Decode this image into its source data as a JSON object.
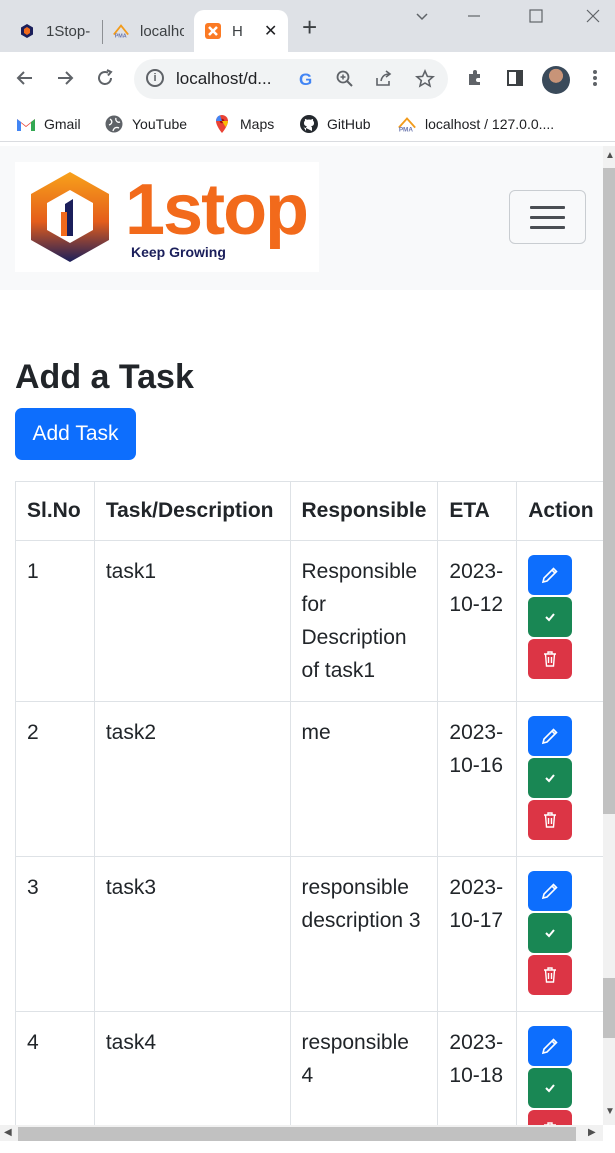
{
  "browser": {
    "tabs": [
      {
        "label": "1Stop-"
      },
      {
        "label": "localho"
      },
      {
        "label": "H"
      }
    ],
    "address": "localhost/d...",
    "bookmarks": [
      {
        "label": "Gmail",
        "icon": "gmail-icon"
      },
      {
        "label": "YouTube",
        "icon": "globe-icon"
      },
      {
        "label": "Maps",
        "icon": "maps-pin-icon"
      },
      {
        "label": "GitHub",
        "icon": "github-icon"
      },
      {
        "label": "localhost / 127.0.0....",
        "icon": "pma-icon"
      }
    ]
  },
  "logo": {
    "word": "1stop",
    "tagline": "Keep Growing"
  },
  "page": {
    "title": "Add a Task",
    "add_button": "Add Task"
  },
  "table": {
    "headers": [
      "Sl.No",
      "Task/Description",
      "Responsible",
      "ETA",
      "Action"
    ],
    "rows": [
      {
        "sl": "1",
        "task": "task1",
        "responsible": "Responsible for Description of task1",
        "eta": "2023-10-12"
      },
      {
        "sl": "2",
        "task": "task2",
        "responsible": "me",
        "eta": "2023-10-16"
      },
      {
        "sl": "3",
        "task": "task3",
        "responsible": "responsible description 3",
        "eta": "2023-10-17"
      },
      {
        "sl": "4",
        "task": "task4",
        "responsible": "responsible 4",
        "eta": "2023-10-18"
      }
    ]
  },
  "colors": {
    "primary": "#0d6efd",
    "success": "#198754",
    "danger": "#dc3545",
    "brand_orange": "#f26a1b",
    "brand_navy": "#1b1f5b"
  }
}
